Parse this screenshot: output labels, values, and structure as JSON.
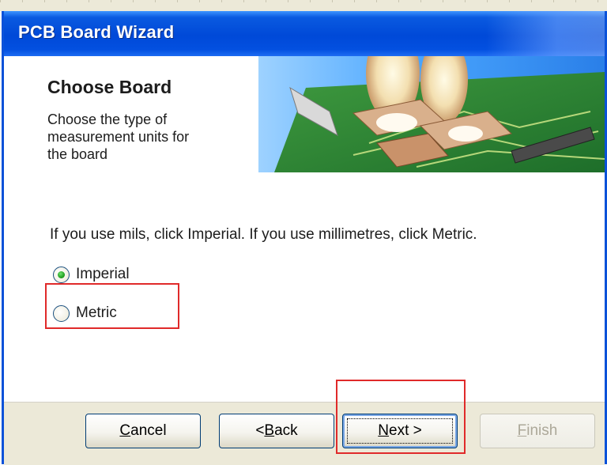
{
  "window": {
    "title": "PCB Board Wizard"
  },
  "header": {
    "title": "Choose Board",
    "description": "Choose the type of measurement units for the board"
  },
  "content": {
    "instruction": "If you use mils, click Imperial. If you use millimetres, click Metric.",
    "options": [
      {
        "label": "Imperial",
        "selected": true
      },
      {
        "label": "Metric",
        "selected": false
      }
    ]
  },
  "buttons": {
    "cancel_prefix": "",
    "cancel_mnemonic": "C",
    "cancel_rest": "ancel",
    "back_prefix": "< ",
    "back_mnemonic": "B",
    "back_rest": "ack",
    "next_prefix": "",
    "next_mnemonic": "N",
    "next_rest": "ext >",
    "finish_prefix": "",
    "finish_mnemonic": "F",
    "finish_rest": "inish",
    "finish_enabled": false
  },
  "colors": {
    "titlebar_blue": "#0049d8",
    "highlight_red": "#e02a2a",
    "button_bar": "#ece9d8",
    "radio_selected_green": "#21a121"
  }
}
